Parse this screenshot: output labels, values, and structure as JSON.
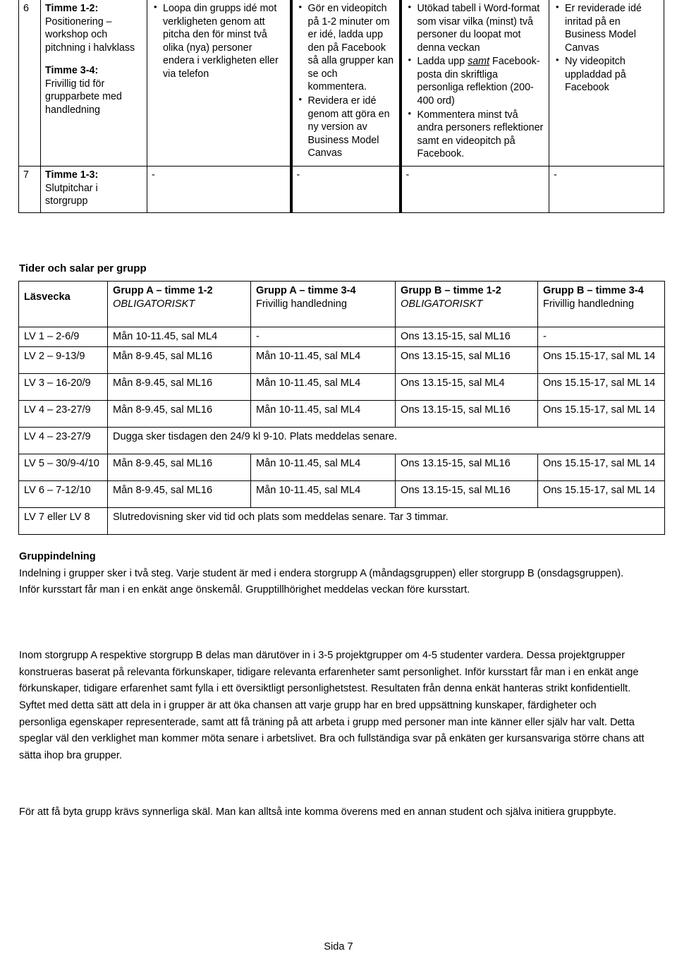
{
  "document": {
    "footer": {
      "page_label": "Sida 7"
    }
  },
  "schedule_table": {
    "columns": [
      "",
      "",
      "",
      "",
      "",
      ""
    ],
    "rows": [
      {
        "number": "6",
        "when": {
          "line1_bold": "Timme 1-2:",
          "line1_text": "Positionering – workshop och pitchning i halvklass",
          "line2_bold": "Timme 3-4:",
          "line2_text": "Frivillig tid för grupparbete med handledning"
        },
        "prep_bullets": [
          "Loopa din grupps idé mot verkligheten genom att pitcha den för minst två olika (nya) personer endera i verkligheten eller via telefon"
        ],
        "activity_bullets": [
          "Gör en videopitch på 1-2 minuter om er idé, ladda upp den på Facebook så alla grupper kan se och kommentera.",
          "Revidera er idé genom att göra en ny version av Business Model Canvas"
        ],
        "deliverable_bullets": [
          {
            "pre": "Utökad tabell i Word-format som visar vilka (minst) två personer du loopat mot denna veckan",
            "emph": "",
            "post": ""
          },
          {
            "pre": "Ladda upp ",
            "emph": "samt",
            "post": " Facebook-posta din skriftliga personliga reflektion (200-400 ord)"
          },
          {
            "pre": "Kommentera minst två andra personers reflektioner samt en videopitch på Facebook.",
            "emph": "",
            "post": ""
          }
        ],
        "result_bullets": [
          "Er reviderade idé inritad på en Business Model Canvas",
          "Ny videopitch uppladdad på Facebook"
        ]
      },
      {
        "number": "7",
        "when": {
          "line1_bold": "Timme 1-3:",
          "line1_text": "Slutpitchar i storgrupp",
          "line2_bold": "",
          "line2_text": ""
        },
        "prep_plain": "-",
        "activity_plain": "-",
        "deliverable_plain": "-",
        "result_plain": "-"
      }
    ]
  },
  "times_section": {
    "heading": "Tider och salar per grupp",
    "headers": {
      "week": "Läsvecka",
      "cols": [
        {
          "title": "Grupp A – timme 1-2",
          "sub": "OBLIGATORISKT",
          "sub_style": "italic"
        },
        {
          "title": "Grupp A – timme 3-4",
          "sub": "Frivillig handledning",
          "sub_style": "normal"
        },
        {
          "title": "Grupp B – timme 1-2",
          "sub": "OBLIGATORISKT",
          "sub_style": "italic"
        },
        {
          "title": "Grupp B – timme 3-4",
          "sub": "Frivillig handledning",
          "sub_style": "normal"
        }
      ]
    },
    "rows": [
      {
        "week": "LV 1 – 2-6/9",
        "span": false,
        "cells": [
          "Mån 10-11.45, sal ML4",
          "-",
          "Ons 13.15-15, sal ML16",
          "-"
        ]
      },
      {
        "week": "LV 2 – 9-13/9",
        "span": false,
        "cells": [
          "Mån 8-9.45, sal ML16",
          "Mån 10-11.45, sal ML4",
          "Ons 13.15-15, sal ML16",
          "Ons 15.15-17, sal ML 14"
        ]
      },
      {
        "week": "LV 3 – 16-20/9",
        "span": false,
        "cells": [
          "Mån 8-9.45, sal ML16",
          "Mån 10-11.45, sal ML4",
          "Ons 13.15-15, sal ML4",
          "Ons 15.15-17, sal ML 14"
        ]
      },
      {
        "week": "LV 4 – 23-27/9",
        "span": false,
        "cells": [
          "Mån 8-9.45, sal ML16",
          "Mån 10-11.45, sal ML4",
          "Ons 13.15-15, sal ML16",
          "Ons 15.15-17, sal ML 14"
        ]
      },
      {
        "week": "LV 4 – 23-27/9",
        "span": true,
        "span_text": "Dugga sker tisdagen den 24/9 kl 9-10. Plats meddelas senare."
      },
      {
        "week": "LV 5 – 30/9-4/10",
        "span": false,
        "cells": [
          "Mån 8-9.45, sal ML16",
          "Mån 10-11.45, sal ML4",
          "Ons 13.15-15, sal ML16",
          "Ons 15.15-17, sal ML 14"
        ]
      },
      {
        "week": "LV 6 – 7-12/10",
        "span": false,
        "cells": [
          "Mån 8-9.45, sal ML16",
          "Mån 10-11.45, sal ML4",
          "Ons 13.15-15, sal ML16",
          "Ons 15.15-17, sal ML 14"
        ]
      },
      {
        "week": "LV 7 eller LV 8",
        "span": true,
        "span_text": "Slutredovisning sker vid tid och plats som meddelas senare. Tar 3 timmar."
      }
    ]
  },
  "prose": {
    "gruppindelning": {
      "heading": "Gruppindelning",
      "text": "Indelning i grupper sker i två steg. Varje student är med i endera storgrupp A (måndagsgruppen) eller storgrupp B (onsdagsgruppen). Inför kursstart får man i en enkät ange önskemål. Grupptillhörighet meddelas veckan före kursstart."
    },
    "inom_storgrupp": {
      "text": "Inom storgrupp A respektive storgrupp B delas man därutöver in i 3-5 projektgrupper om 4-5 studenter vardera. Dessa projektgrupper konstrueras baserat på relevanta förkunskaper, tidigare relevanta erfarenheter samt personlighet. Inför kursstart får man i en enkät ange förkunskaper, tidigare erfarenhet samt fylla i ett översiktligt personlighetstest. Resultaten från denna enkät hanteras strikt konfidentiellt. Syftet med detta sätt att dela in i grupper är att öka chansen att varje grupp har en bred uppsättning kunskaper, färdigheter och personliga egenskaper representerade, samt att få träning på att arbeta i grupp med personer man inte känner eller själv har valt. Detta speglar väl den verklighet man kommer möta senare i arbetslivet. Bra och fullständiga svar på enkäten ger  kursansvariga större chans att sätta ihop bra grupper."
    },
    "byta_grupp": {
      "text": "För att få byta grupp krävs synnerliga skäl. Man kan alltså inte komma överens med en annan student och själva initiera gruppbyte."
    }
  }
}
